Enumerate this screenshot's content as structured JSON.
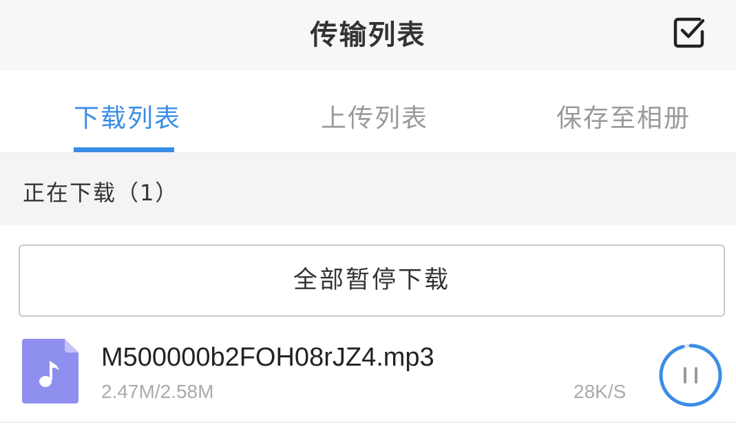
{
  "header": {
    "title": "传输列表",
    "edit_icon": "checkbox-edit-icon"
  },
  "tabs": [
    {
      "label": "下载列表",
      "active": true
    },
    {
      "label": "上传列表",
      "active": false
    },
    {
      "label": "保存至相册",
      "active": false
    }
  ],
  "section": {
    "title": "正在下载（1）"
  },
  "actions": {
    "pause_all_label": "全部暂停下载"
  },
  "downloads": [
    {
      "icon": "music-file-icon",
      "file_name": "M500000b2FOH08rJZ4.mp3",
      "size_progress": "2.47M/2.58M",
      "speed": "28K/S",
      "progress": 0.957,
      "control_icon": "pause-icon"
    }
  ],
  "colors": {
    "accent": "#3a8de6",
    "file_icon": "#8f8ff0",
    "muted_text": "#aaaaaa",
    "header_bg": "#f7f7f8",
    "section_bg": "#f4f4f5"
  }
}
